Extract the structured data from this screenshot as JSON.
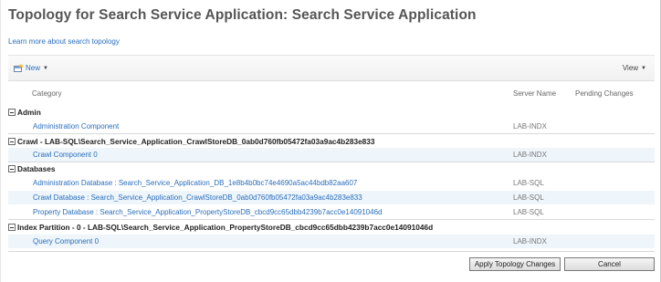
{
  "page": {
    "title": "Topology for Search Service Application: Search Service Application",
    "learn_more": "Learn more about search topology"
  },
  "toolbar": {
    "new_label": "New",
    "view_label": "View"
  },
  "columns": {
    "category": "Category",
    "server_name": "Server Name",
    "pending_changes": "Pending Changes"
  },
  "groups": [
    {
      "label": "Admin",
      "rows": [
        {
          "name": "Administration Component",
          "server": "LAB-INDX"
        }
      ]
    },
    {
      "label": "Crawl - LAB-SQL\\Search_Service_Application_CrawlStoreDB_0ab0d760fb05472fa03a9ac4b283e833",
      "rows": [
        {
          "name": "Crawl Component 0",
          "server": "LAB-INDX"
        }
      ]
    },
    {
      "label": "Databases",
      "rows": [
        {
          "name": "Administration Database : Search_Service_Application_DB_1e8b4b0bc74e4690a5ac44bdb82aa607",
          "server": "LAB-SQL"
        },
        {
          "name": "Crawl Database : Search_Service_Application_CrawlStoreDB_0ab0d760fb05472fa03a9ac4b283e833",
          "server": "LAB-SQL"
        },
        {
          "name": "Property Database : Search_Service_Application_PropertyStoreDB_cbcd9cc65dbb4239b7acc0e14091046d",
          "server": "LAB-SQL"
        }
      ]
    },
    {
      "label": "Index Partition - 0 - LAB-SQL\\Search_Service_Application_PropertyStoreDB_cbcd9cc65dbb4239b7acc0e14091046d",
      "rows": [
        {
          "name": "Query Component 0",
          "server": "LAB-INDX"
        }
      ]
    }
  ],
  "buttons": {
    "apply": "Apply Topology Changes",
    "cancel": "Cancel"
  },
  "icons": {
    "new": "new-item-icon",
    "collapse": "collapse-icon",
    "dropdown": "dropdown-caret-icon"
  }
}
